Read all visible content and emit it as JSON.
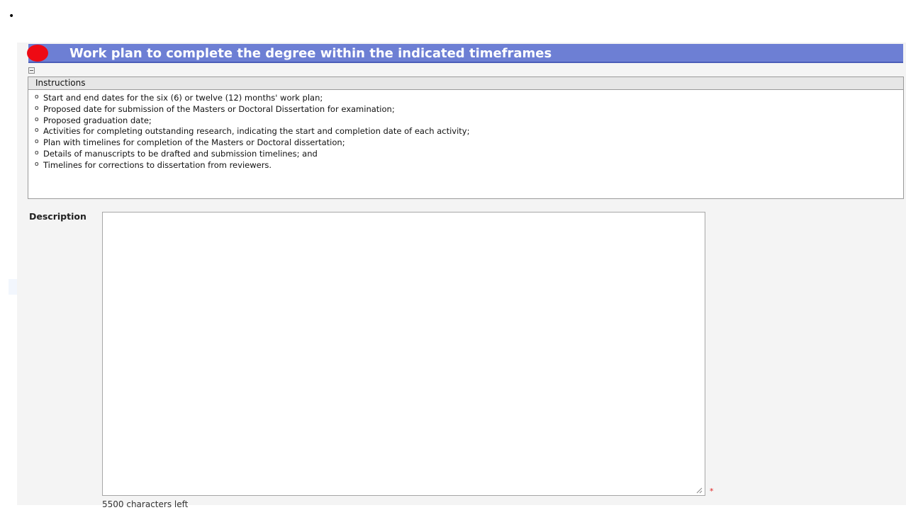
{
  "page": {
    "bullet": "•"
  },
  "section": {
    "title": "Work plan to complete the degree within the indicated timeframes",
    "status_color": "#ee0a14",
    "header_color": "#6d7fd4"
  },
  "instructions": {
    "header": "Instructions",
    "bullet_symbol": "o",
    "items": [
      "Start and end dates for the six (6) or twelve (12) months' work plan;",
      "Proposed date for submission of the Masters or Doctoral Dissertation for examination;",
      "Proposed graduation date;",
      "Activities for completing outstanding research, indicating the start and completion date of each activity;",
      "Plan with timelines for completion of the Masters or Doctoral dissertation;",
      "Details of manuscripts to be drafted and submission timelines; and",
      "Timelines for corrections to dissertation from reviewers."
    ]
  },
  "description": {
    "label": "Description",
    "value": "",
    "required_mark": "*",
    "chars_left": "5500 characters left"
  }
}
